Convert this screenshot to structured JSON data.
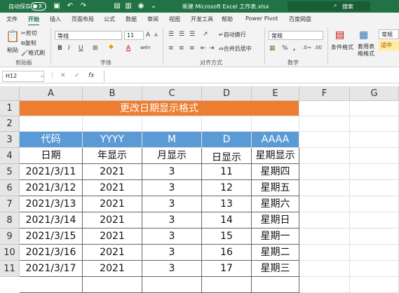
{
  "titlebar": {
    "autosave": "自动保存",
    "toggle": "关",
    "title": "新建 Microsoft Excel 工作表.xlsx",
    "search": "搜索",
    "qa_icons": [
      "save-icon",
      "undo-icon",
      "redo-icon",
      "new-file-icon",
      "camera-icon",
      "dropdown-icon"
    ]
  },
  "menu": [
    "文件",
    "开始",
    "插入",
    "页面布局",
    "公式",
    "数据",
    "审阅",
    "视图",
    "开发工具",
    "帮助",
    "Power Pivot",
    "百度网盘"
  ],
  "ribbon": {
    "paste": "粘贴",
    "cut": "剪切",
    "copy": "复制",
    "format_painter": "格式刷",
    "clipboard": "剪贴板",
    "font_name": "等线",
    "font_size": "11",
    "bold": "B",
    "italic": "I",
    "underline": "U",
    "font_color_glyph": "A",
    "phonetic_glyph": "wén",
    "font_group": "字体",
    "wrap": "自动换行",
    "merge": "合并后居中",
    "align_group": "对齐方式",
    "number_format": "常规",
    "number_group": "数字",
    "percent": "%",
    "comma": ",",
    "cond_format": "条件格式",
    "table_format": "套用表格格式",
    "style_normal": "常规",
    "style_neutral": "适中",
    "accent": "#217346"
  },
  "formula_bar": {
    "name_box": "H12",
    "cancel": "✕",
    "enter": "✓",
    "fx": "fx",
    "value": ""
  },
  "sheet": {
    "columns": [
      "A",
      "B",
      "C",
      "D",
      "E",
      "F",
      "G"
    ],
    "rows": [
      "1",
      "2",
      "3",
      "4",
      "5",
      "6",
      "7",
      "8",
      "9",
      "10",
      "11"
    ],
    "title": "更改日期显示格式",
    "header_row": [
      "代码",
      "YYYY",
      "M",
      "D",
      "AAAA"
    ],
    "label_row": [
      "日期",
      "年显示",
      "月显示",
      "日显示",
      "星期显示"
    ],
    "data": [
      [
        "2021/3/11",
        "2021",
        "3",
        "11",
        "星期四"
      ],
      [
        "2021/3/12",
        "2021",
        "3",
        "12",
        "星期五"
      ],
      [
        "2021/3/13",
        "2021",
        "3",
        "13",
        "星期六"
      ],
      [
        "2021/3/14",
        "2021",
        "3",
        "14",
        "星期日"
      ],
      [
        "2021/3/15",
        "2021",
        "3",
        "15",
        "星期一"
      ],
      [
        "2021/3/16",
        "2021",
        "3",
        "16",
        "星期二"
      ],
      [
        "2021/3/17",
        "2021",
        "3",
        "17",
        "星期三"
      ]
    ],
    "title_color": "#ed7d31",
    "header_color": "#5b9bd5"
  }
}
